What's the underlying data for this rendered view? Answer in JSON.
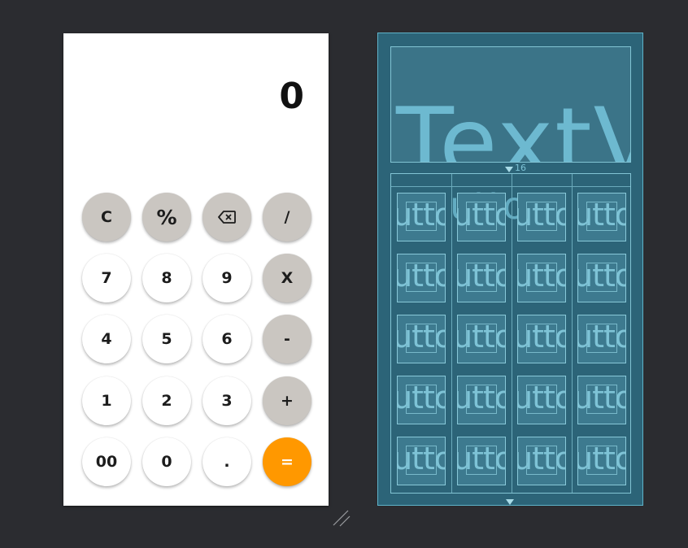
{
  "design_preview": {
    "display_value": "0",
    "rows": [
      [
        {
          "label": "C",
          "name": "clear-button",
          "style": "func"
        },
        {
          "label": "%",
          "name": "percent-button",
          "style": "func pct"
        },
        {
          "label": "",
          "name": "backspace-button",
          "style": "func bksp",
          "icon": "backspace-icon"
        },
        {
          "label": "/",
          "name": "divide-button",
          "style": "func"
        }
      ],
      [
        {
          "label": "7",
          "name": "digit-7-button",
          "style": ""
        },
        {
          "label": "8",
          "name": "digit-8-button",
          "style": ""
        },
        {
          "label": "9",
          "name": "digit-9-button",
          "style": ""
        },
        {
          "label": "X",
          "name": "multiply-button",
          "style": "func"
        }
      ],
      [
        {
          "label": "4",
          "name": "digit-4-button",
          "style": ""
        },
        {
          "label": "5",
          "name": "digit-5-button",
          "style": ""
        },
        {
          "label": "6",
          "name": "digit-6-button",
          "style": ""
        },
        {
          "label": "-",
          "name": "subtract-button",
          "style": "func"
        }
      ],
      [
        {
          "label": "1",
          "name": "digit-1-button",
          "style": ""
        },
        {
          "label": "2",
          "name": "digit-2-button",
          "style": ""
        },
        {
          "label": "3",
          "name": "digit-3-button",
          "style": ""
        },
        {
          "label": "+",
          "name": "add-button",
          "style": "func"
        }
      ],
      [
        {
          "label": "00",
          "name": "double-zero-button",
          "style": ""
        },
        {
          "label": "0",
          "name": "digit-0-button",
          "style": ""
        },
        {
          "label": ".",
          "name": "decimal-button",
          "style": ""
        },
        {
          "label": "=",
          "name": "equals-button",
          "style": "eq"
        }
      ]
    ]
  },
  "blueprint": {
    "text_watermark": "TextView",
    "grid_ghost_label": "utton",
    "cell_label": "utto",
    "margin_label": "16",
    "rows": 5,
    "cols": 4
  },
  "colors": {
    "func_button": "#cac6c1",
    "equals_button": "#ff9800",
    "blueprint_bg": "#2c6478",
    "canvas_bg": "#2b2c30"
  }
}
